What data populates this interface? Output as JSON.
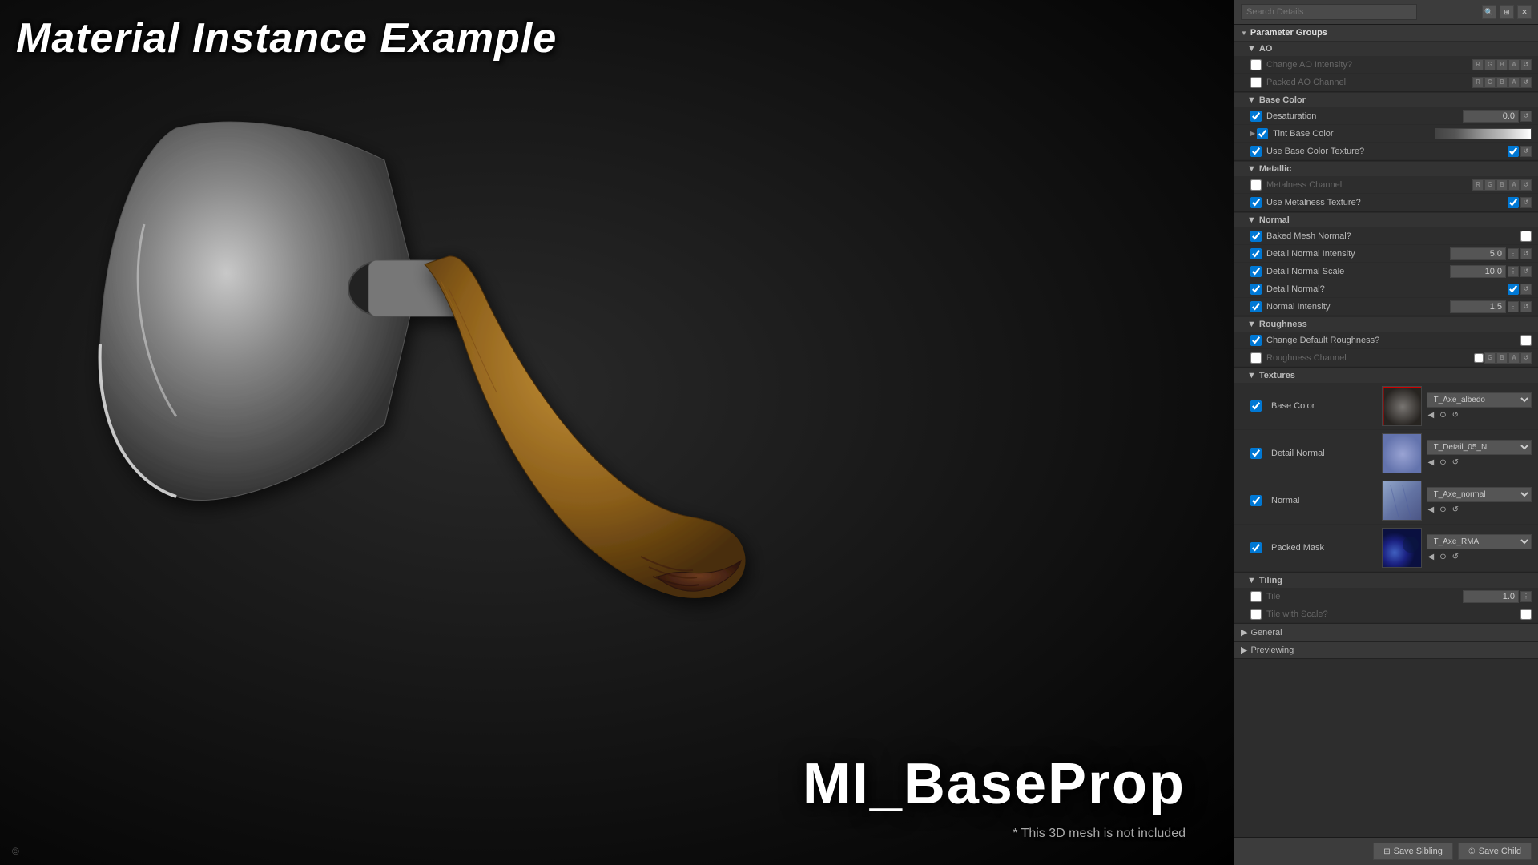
{
  "viewport": {
    "title": "Material Instance Example",
    "modelName": "MI_BaseProp",
    "modelNote": "* This 3D mesh is not included",
    "watermark": "©"
  },
  "panel": {
    "searchPlaceholder": "Search Details",
    "sectionTitle": "Parameter Groups",
    "groups": {
      "ao": {
        "label": "AO",
        "params": [
          {
            "id": "change-ao-intensity",
            "label": "Change AO Intensity?",
            "checked": false,
            "disabled": true,
            "valueType": "channels"
          },
          {
            "id": "packed-ao-channel",
            "label": "Packed AO Channel",
            "checked": false,
            "disabled": true,
            "valueType": "channels"
          }
        ]
      },
      "baseColor": {
        "label": "Base Color",
        "params": [
          {
            "id": "desaturation",
            "label": "Desaturation",
            "checked": true,
            "valueType": "number",
            "value": "0.0"
          },
          {
            "id": "tint-base-color",
            "label": "Tint Base Color",
            "checked": true,
            "hasExpand": true,
            "valueType": "colorbar"
          },
          {
            "id": "use-base-color-texture",
            "label": "Use Base Color Texture?",
            "checked": true,
            "valueType": "checkonly"
          }
        ]
      },
      "metallic": {
        "label": "Metallic",
        "params": [
          {
            "id": "metalness-channel",
            "label": "Metalness Channel",
            "checked": false,
            "disabled": true,
            "valueType": "channels"
          },
          {
            "id": "use-metalness-texture",
            "label": "Use Metalness Texture?",
            "checked": true,
            "valueType": "checkonly"
          }
        ]
      },
      "normal": {
        "label": "Normal",
        "params": [
          {
            "id": "baked-mesh-normal",
            "label": "Baked Mesh Normal?",
            "checked": true,
            "valueType": "singlecheck"
          },
          {
            "id": "detail-normal-intensity",
            "label": "Detail Normal Intensity",
            "checked": true,
            "valueType": "number",
            "value": "5.0"
          },
          {
            "id": "detail-normal-scale",
            "label": "Detail Normal Scale",
            "checked": true,
            "valueType": "number",
            "value": "10.0"
          },
          {
            "id": "detail-normal",
            "label": "Detail Normal?",
            "checked": true,
            "valueType": "checkonly"
          },
          {
            "id": "normal-intensity",
            "label": "Normal Intensity",
            "checked": true,
            "valueType": "number",
            "value": "1.5"
          }
        ]
      },
      "roughness": {
        "label": "Roughness",
        "params": [
          {
            "id": "change-default-roughness",
            "label": "Change Default Roughness?",
            "checked": true,
            "valueType": "singlecheck"
          },
          {
            "id": "roughness-channel",
            "label": "Roughness Channel",
            "checked": false,
            "disabled": true,
            "valueType": "channels"
          }
        ]
      }
    },
    "textures": {
      "label": "Textures",
      "items": [
        {
          "id": "base-color-tex",
          "label": "Base Color",
          "checked": true,
          "textureName": "T_Axe_albedo",
          "thumbType": "albedo"
        },
        {
          "id": "detail-normal-tex",
          "label": "Detail Normal",
          "checked": true,
          "textureName": "T_Detail_05_N",
          "thumbType": "detail"
        },
        {
          "id": "normal-tex",
          "label": "Normal",
          "checked": true,
          "textureName": "T_Axe_normal",
          "thumbType": "normal"
        },
        {
          "id": "packed-mask-tex",
          "label": "Packed Mask",
          "checked": true,
          "textureName": "T_Axe_RMA",
          "thumbType": "rma"
        }
      ]
    },
    "tiling": {
      "label": "Tiling",
      "params": [
        {
          "id": "tile",
          "label": "Tile",
          "checked": false,
          "valueType": "number",
          "value": "1.0"
        },
        {
          "id": "tile-with-scale",
          "label": "Tile with Scale?",
          "checked": false,
          "valueType": "singlecheck"
        }
      ]
    },
    "footer": {
      "saveSiblingLabel": "Save Sibling",
      "saveChildLabel": "Save Child"
    },
    "general": {
      "label": "General"
    },
    "previewing": {
      "label": "Previewing"
    }
  }
}
